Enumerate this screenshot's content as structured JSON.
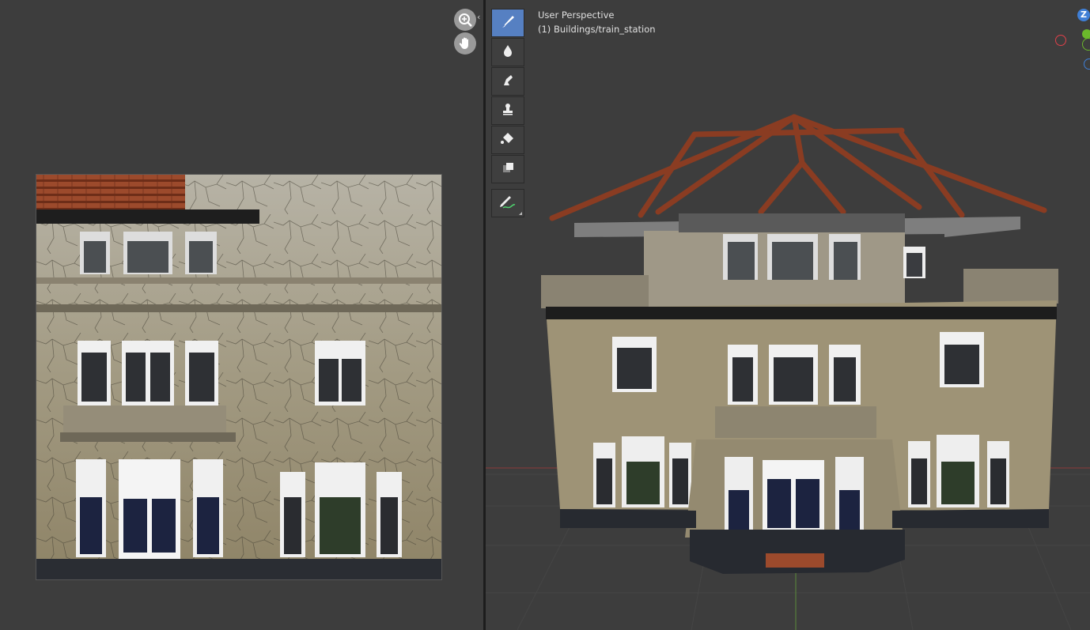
{
  "viewport": {
    "view_name": "User Perspective",
    "object_label": "(1) Buildings/train_station"
  },
  "image_editor": {
    "nav_buttons": [
      "zoom-icon",
      "hand-pan-icon"
    ]
  },
  "toolbar": {
    "tools": [
      {
        "name": "draw-brush-icon",
        "active": true
      },
      {
        "name": "soften-drop-icon",
        "active": false
      },
      {
        "name": "smear-icon",
        "active": false
      },
      {
        "name": "clone-stamp-icon",
        "active": false
      },
      {
        "name": "fill-bucket-icon",
        "active": false
      },
      {
        "name": "mask-icon",
        "active": false
      },
      {
        "name": "annotate-pencil-icon",
        "active": false
      }
    ]
  },
  "gizmo": {
    "z_label": "Z",
    "colors": {
      "x": "#e0404a",
      "y": "#6bb82b",
      "z": "#3f7fd6"
    }
  },
  "colors": {
    "editor_bg": "#3d3d3d",
    "viewport_bg": "#3a3a3a",
    "active_tool": "#5680c2"
  }
}
